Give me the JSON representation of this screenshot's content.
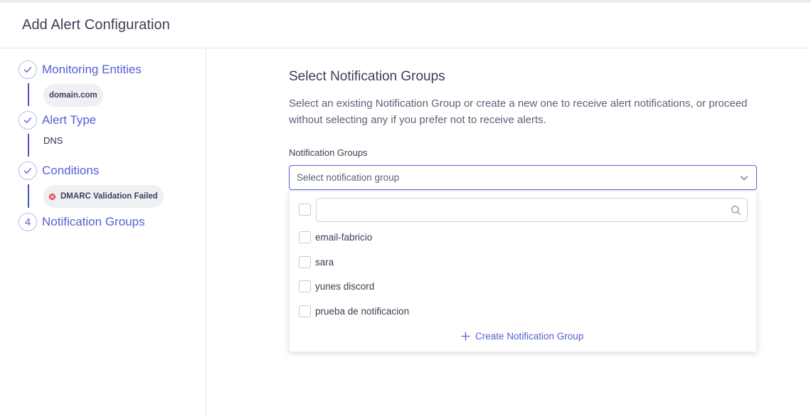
{
  "header": {
    "title": "Add Alert Configuration"
  },
  "steps": [
    {
      "marker": "check-icon",
      "label": "Monitoring Entities",
      "value": "domain.com"
    },
    {
      "marker": "check-icon",
      "label": "Alert Type",
      "value": "DNS"
    },
    {
      "marker": "check-icon",
      "label": "Conditions",
      "value": "DMARC Validation Failed"
    },
    {
      "marker": "4",
      "label": "Notification Groups"
    }
  ],
  "main": {
    "title": "Select Notification Groups",
    "description": "Select an existing Notification Group or create a new one to receive alert notifications, or proceed without selecting any if you prefer not to receive alerts.",
    "field_label": "Notification Groups",
    "select_placeholder": "Select notification group",
    "search": {
      "placeholder": "",
      "value": ""
    },
    "options": [
      {
        "label": "email-fabricio",
        "checked": false
      },
      {
        "label": "sara",
        "checked": false
      },
      {
        "label": "yunes discord",
        "checked": false
      },
      {
        "label": "prueba de notificacion",
        "checked": false
      }
    ],
    "create_label": "Create Notification Group"
  },
  "colors": {
    "accent": "#5560d4",
    "connector": "#4a52c8",
    "error": "#e0413e",
    "chip_bg": "#eff0f4"
  },
  "icons": {
    "step_complete": "check-icon",
    "select_toggle": "chevron-down-icon",
    "search": "search-icon",
    "create": "plus-icon",
    "condition_status": "error-x-icon"
  }
}
